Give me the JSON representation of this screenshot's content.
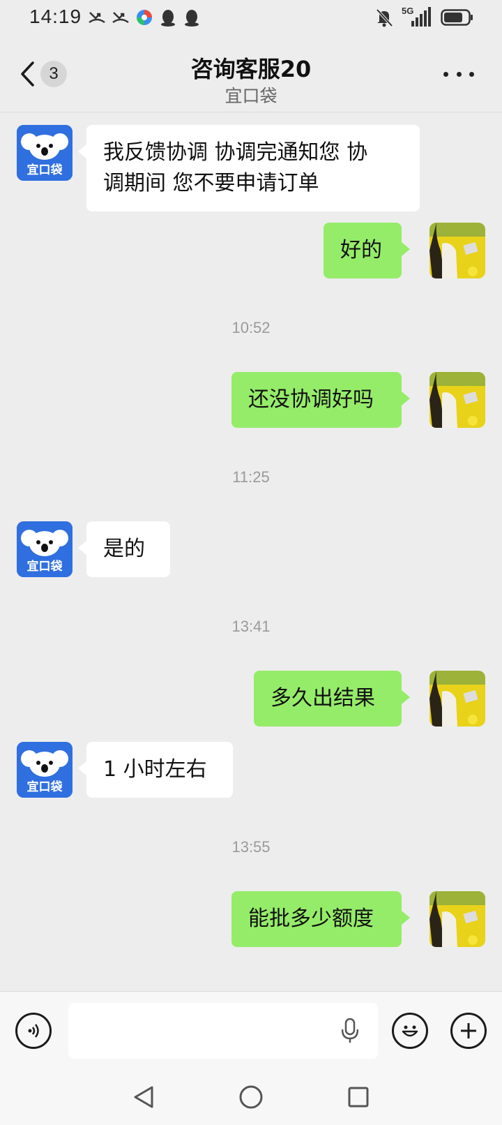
{
  "status": {
    "time": "14:19",
    "network": "5G"
  },
  "header": {
    "back_count": "3",
    "title": "咨询客服20",
    "subtitle": "宜口袋"
  },
  "brand": {
    "avatar_text": "宜口袋",
    "accent": "#2f6fe0",
    "bubble_out": "#95ec69"
  },
  "messages": [
    {
      "sender": "service",
      "text_line1": "我反馈协调 协调完通知您  协",
      "text_line2": "调期间 您不要申请订单"
    },
    {
      "sender": "me",
      "text": "好的"
    },
    {
      "time": "10:52"
    },
    {
      "sender": "me",
      "text": "还没协调好吗"
    },
    {
      "time": "11:25"
    },
    {
      "sender": "service",
      "text": "是的"
    },
    {
      "time": "13:41"
    },
    {
      "sender": "me",
      "text": "多久出结果"
    },
    {
      "sender": "service",
      "text": "1 小时左右"
    },
    {
      "time": "13:55"
    },
    {
      "sender": "me",
      "text": "能批多少额度"
    }
  ],
  "input": {
    "placeholder": ""
  }
}
